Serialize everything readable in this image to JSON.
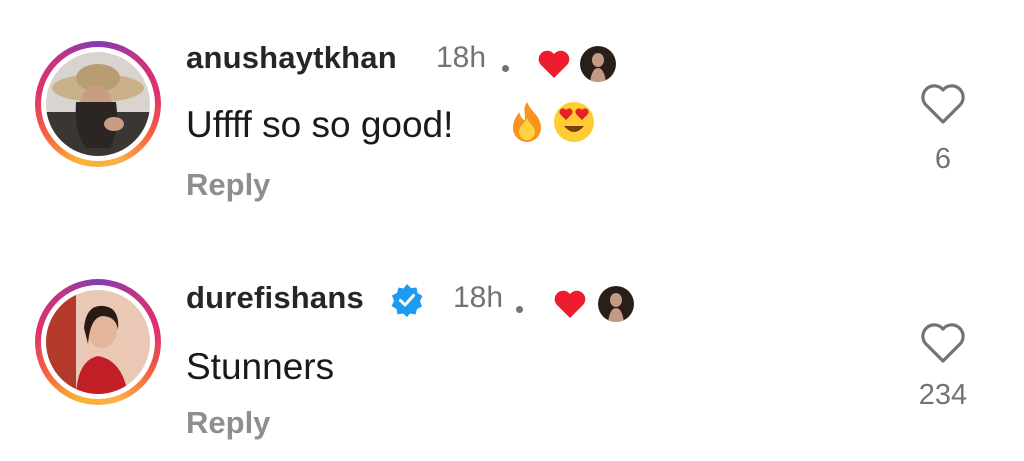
{
  "comments": [
    {
      "username": "anushaytkhan",
      "verified": false,
      "timestamp": "18h",
      "text": "Uffff so so good!",
      "emojis": [
        "fire",
        "heart-eyes"
      ],
      "reply_label": "Reply",
      "likes": "6",
      "liked_by_creator": true
    },
    {
      "username": "durefishans",
      "verified": true,
      "timestamp": "18h",
      "text": "Stunners",
      "emojis": [],
      "reply_label": "Reply",
      "likes": "234",
      "liked_by_creator": true
    }
  ],
  "colors": {
    "creator_heart": "#ed1d2f",
    "verified_badge": "#1d9bf0",
    "muted_text": "#737373",
    "reply_text": "#8e8e8e"
  },
  "icons": {
    "like": "heart-outline-icon",
    "creator_like": "heart-filled-icon",
    "verified": "verified-badge-icon"
  }
}
